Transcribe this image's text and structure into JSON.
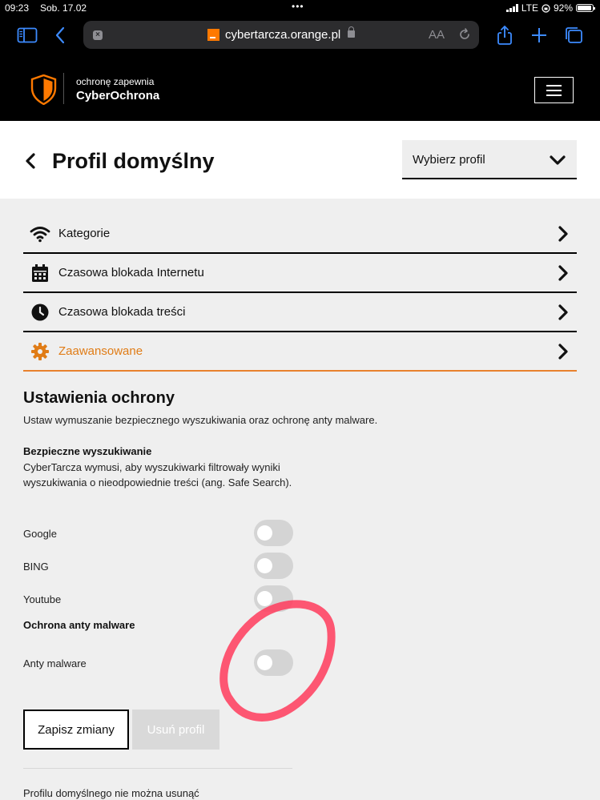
{
  "status_bar": {
    "time": "09:23",
    "date": "Sob. 17.02",
    "network": "LTE",
    "battery": "92%"
  },
  "browser": {
    "url": "cybertarcza.orange.pl",
    "reader_label": "AA"
  },
  "site_header": {
    "line1": "ochronę zapewnia",
    "line2": "CyberOchrona"
  },
  "profile": {
    "title": "Profil domyślny",
    "select_label": "Wybierz profil"
  },
  "menu": {
    "items": [
      {
        "label": "Kategorie",
        "icon": "wifi-icon"
      },
      {
        "label": "Czasowa blokada Internetu",
        "icon": "calendar-icon"
      },
      {
        "label": "Czasowa blokada treści",
        "icon": "clock-icon"
      },
      {
        "label": "Zaawansowane",
        "icon": "gear-icon",
        "active": true
      }
    ]
  },
  "settings": {
    "title": "Ustawienia ochrony",
    "description": "Ustaw wymuszanie bezpiecznego wyszukiwania oraz ochronę anty malware.",
    "safe_search": {
      "title": "Bezpieczne wyszukiwanie",
      "description": "CyberTarcza wymusi, aby wyszukiwarki filtrowały wyniki wyszukiwania o nieodpowiednie treści (ang. Safe Search).",
      "toggles": [
        {
          "label": "Google",
          "on": false
        },
        {
          "label": "BING",
          "on": false
        },
        {
          "label": "Youtube",
          "on": false
        }
      ]
    },
    "malware": {
      "title": "Ochrona anty malware",
      "toggle_label": "Anty malware",
      "on": false
    }
  },
  "actions": {
    "save_label": "Zapisz zmiany",
    "delete_label": "Usuń profil",
    "note": "Profilu domyślnego nie można usunąć"
  },
  "colors": {
    "accent": "#e07c16",
    "annotation": "#ff3b5c",
    "header_bg": "#000000"
  }
}
